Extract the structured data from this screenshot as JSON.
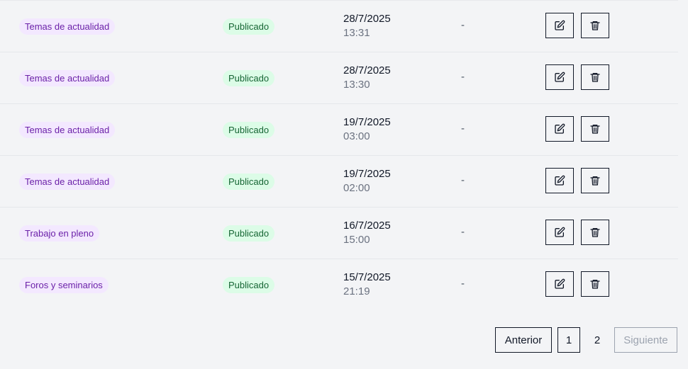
{
  "rows": [
    {
      "category": "Temas de actualidad",
      "status": "Publicado",
      "date": "28/7/2025",
      "time": "13:31",
      "extra": "-"
    },
    {
      "category": "Temas de actualidad",
      "status": "Publicado",
      "date": "28/7/2025",
      "time": "13:30",
      "extra": "-"
    },
    {
      "category": "Temas de actualidad",
      "status": "Publicado",
      "date": "19/7/2025",
      "time": "03:00",
      "extra": "-"
    },
    {
      "category": "Temas de actualidad",
      "status": "Publicado",
      "date": "19/7/2025",
      "time": "02:00",
      "extra": "-"
    },
    {
      "category": "Trabajo en pleno",
      "status": "Publicado",
      "date": "16/7/2025",
      "time": "15:00",
      "extra": "-"
    },
    {
      "category": "Foros y seminarios",
      "status": "Publicado",
      "date": "15/7/2025",
      "time": "21:19",
      "extra": "-"
    }
  ],
  "actions": {
    "edit_icon": "edit-icon",
    "delete_icon": "trash-icon"
  },
  "pagination": {
    "prev": "Anterior",
    "page1": "1",
    "page2": "2",
    "next": "Siguiente"
  },
  "colors": {
    "category_bg": "#f3e8ff",
    "category_text": "#6b21a8",
    "status_bg": "#dcfce7",
    "status_text": "#166534"
  }
}
